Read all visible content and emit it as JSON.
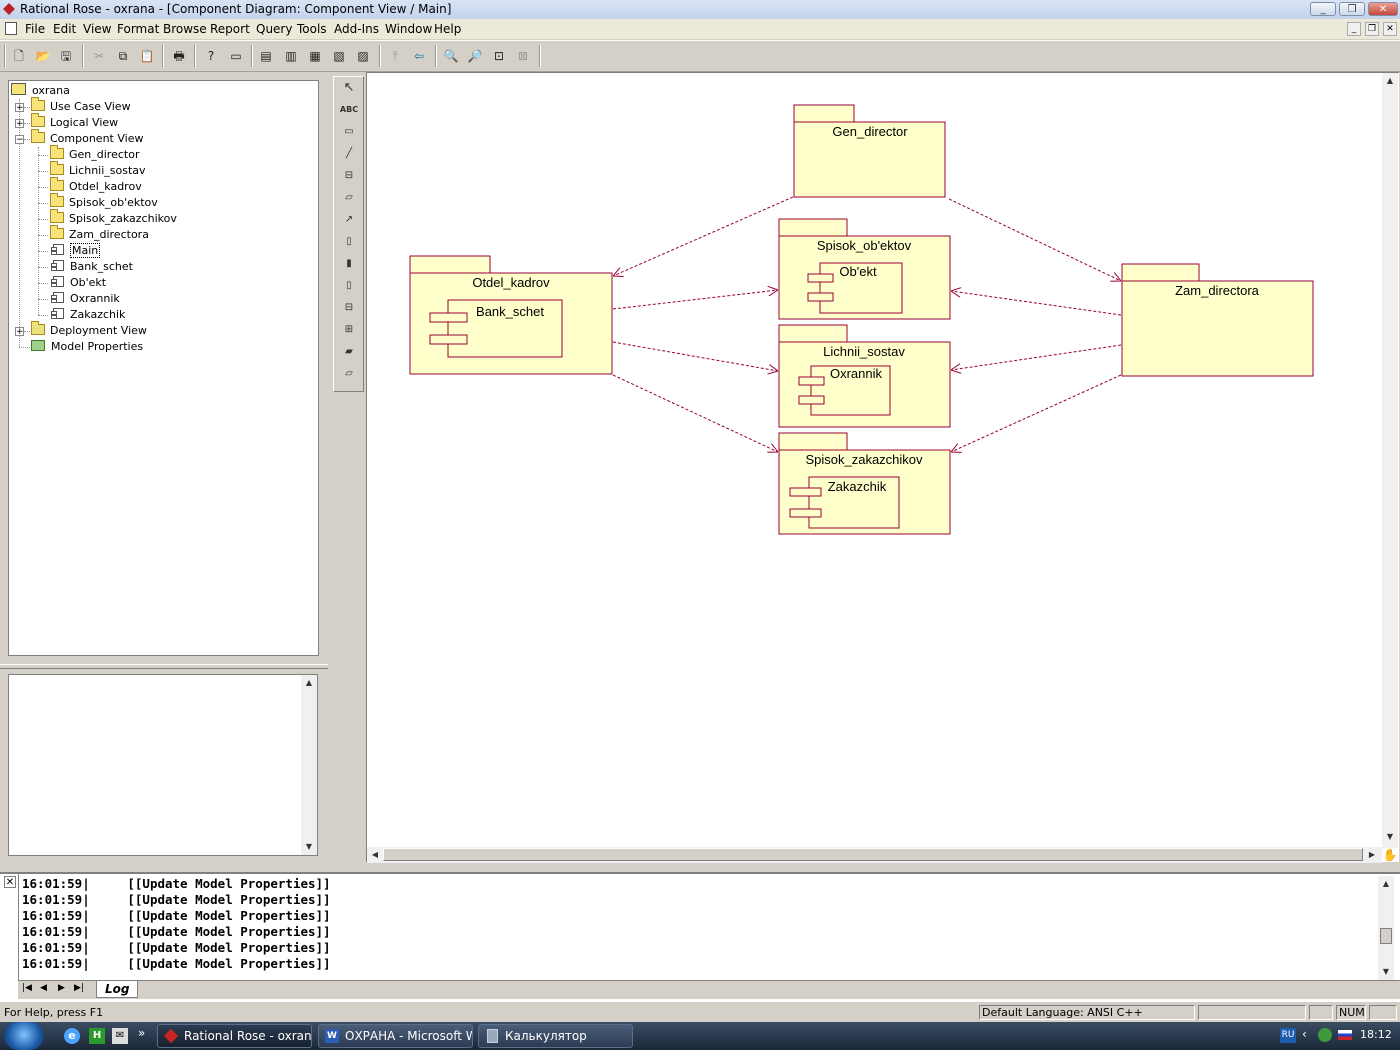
{
  "window": {
    "title": "Rational Rose - oxrana - [Component Diagram: Component View / Main]"
  },
  "menu": [
    "File",
    "Edit",
    "View",
    "Format",
    "Browse",
    "Report",
    "Query",
    "Tools",
    "Add-Ins",
    "Window",
    "Help"
  ],
  "tree": {
    "root": "oxrana",
    "items": [
      {
        "label": "Use Case View"
      },
      {
        "label": "Logical View"
      },
      {
        "label": "Component View"
      },
      {
        "label": "Gen_director"
      },
      {
        "label": "Lichnii_sostav"
      },
      {
        "label": "Otdel_kadrov"
      },
      {
        "label": "Spisok_ob'ektov"
      },
      {
        "label": "Spisok_zakazchikov"
      },
      {
        "label": "Zam_directora"
      },
      {
        "label": "Main"
      },
      {
        "label": "Bank_schet"
      },
      {
        "label": "Ob'ekt"
      },
      {
        "label": "Oxrannik"
      },
      {
        "label": "Zakazchik"
      },
      {
        "label": "Deployment View"
      },
      {
        "label": "Model Properties"
      }
    ]
  },
  "palette": {
    "text_tool": "ABC"
  },
  "diagram": {
    "packages": {
      "gen_director": "Gen_director",
      "spisok_obektov": "Spisok_ob'ektov",
      "otdel_kadrov": "Otdel_kadrov",
      "zam_directora": "Zam_directora",
      "lichnii_sostav": "Lichnii_sostav",
      "spisok_zakazchikov": "Spisok_zakazchikov"
    },
    "components": {
      "bank_schet": "Bank_schet",
      "obekt": "Ob'ekt",
      "oxrannik": "Oxrannik",
      "zakazchik": "Zakazchik"
    },
    "colors": {
      "fill": "#ffffcc",
      "stroke": "#990033"
    }
  },
  "log": {
    "lines": [
      {
        "time": "16:01:59|",
        "msg": "[[Update Model Properties]]"
      },
      {
        "time": "16:01:59|",
        "msg": "[[Update Model Properties]]"
      },
      {
        "time": "16:01:59|",
        "msg": "[[Update Model Properties]]"
      },
      {
        "time": "16:01:59|",
        "msg": "[[Update Model Properties]]"
      },
      {
        "time": "16:01:59|",
        "msg": "[[Update Model Properties]]"
      },
      {
        "time": "16:01:59|",
        "msg": "[[Update Model Properties]]"
      }
    ],
    "tab": "Log"
  },
  "status": {
    "help": "For Help, press F1",
    "language": "Default Language: ANSI C++",
    "num": "NUM"
  },
  "taskbar": {
    "tasks": [
      "Rational Rose - oxran...",
      "ОХРАНА - Microsoft W...",
      "Калькулятор"
    ],
    "lang": "RU",
    "clock": "18:12"
  }
}
